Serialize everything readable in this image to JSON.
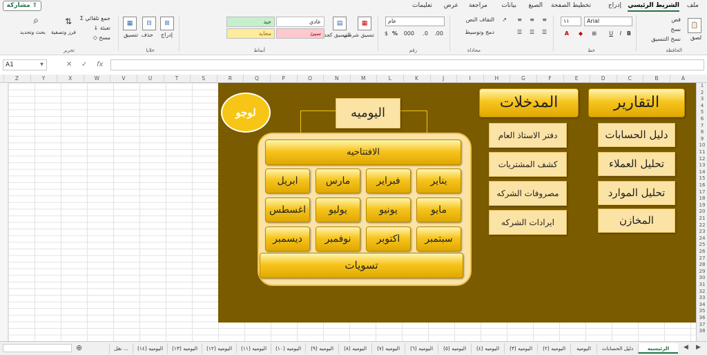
{
  "menu": {
    "file": "ملف",
    "home": "الشريط الرئيسي",
    "insert": "إدراج",
    "page_layout": "تخطيط الصفحة",
    "formulas": "الصيغ",
    "data": "بيانات",
    "review": "مراجعة",
    "view": "عرض",
    "help": "تعليمات",
    "share": "مشاركة"
  },
  "ribbon": {
    "clipboard": {
      "paste": "لصق",
      "cut": "قص",
      "copy": "نسخ",
      "format_painter": "نسخ التنسيق",
      "label": "الحافظة"
    },
    "font": {
      "name": "Arial",
      "size": "١١",
      "label": "خط"
    },
    "alignment": {
      "wrap": "التفاف النص",
      "merge": "دمج وتوسيط",
      "label": "محاذاة"
    },
    "number": {
      "format": "عام",
      "label": "رقم"
    },
    "styles": {
      "conditional": "تنسيق شرطي",
      "table": "التنسيق كجدول",
      "normal": "عادي",
      "good": "جيد",
      "bad": "سيئ",
      "neutral": "محايد",
      "label": "أنماط"
    },
    "cells": {
      "insert": "إدراج",
      "delete": "حذف",
      "format": "تنسيق",
      "label": "خلايا"
    },
    "editing": {
      "autosum": "جمع تلقائي",
      "fill": "تعبئة",
      "clear": "مسح",
      "sort": "فرز وتصفية",
      "find": "بحث وتحديد",
      "label": "تحرير"
    }
  },
  "formula_bar": {
    "name_box": "A1",
    "fx": "fx",
    "value": ""
  },
  "columns": [
    "A",
    "B",
    "C",
    "D",
    "E",
    "F",
    "G",
    "H",
    "I",
    "J",
    "K",
    "L",
    "M",
    "N",
    "O",
    "P",
    "Q",
    "R",
    "S",
    "T",
    "U",
    "V",
    "W",
    "X",
    "Y",
    "Z"
  ],
  "rows": [
    "1",
    "2",
    "3",
    "4",
    "5",
    "6",
    "7",
    "8",
    "9",
    "10",
    "11",
    "12",
    "13",
    "14",
    "15",
    "16",
    "17",
    "18",
    "19",
    "20",
    "21",
    "22",
    "23",
    "24",
    "25",
    "26",
    "27",
    "28",
    "29",
    "30",
    "31",
    "32",
    "33",
    "34",
    "35",
    "36",
    "37",
    "38"
  ],
  "dashboard": {
    "logo": "لوجو",
    "reports_title": "التقارير",
    "reports": [
      "دليل الحسابات",
      "تحليل العملاء",
      "تحليل الموارد",
      "المخازن"
    ],
    "inputs_title": "المدخلات",
    "inputs": [
      "دفتر الاستاذ العام",
      "كشف المشتريات",
      "مصروفات الشركه",
      "ايرادات الشركه"
    ],
    "daily_title": "اليوميه",
    "opening": "الافتتاحيه",
    "months": [
      "يناير",
      "فبراير",
      "مارس",
      "ابريل",
      "مايو",
      "يونيو",
      "يوليو",
      "اغسطس",
      "سبتمبر",
      "اكتوبر",
      "نوفمبر",
      "ديسمبر"
    ],
    "settlements": "تسويات"
  },
  "sheet_tabs": [
    "الرئيسيه",
    "دليل الحسابات",
    "اليوميه",
    "اليوميه (٢)",
    "اليوميه (٣)",
    "اليوميه (٤)",
    "اليوميه (٥)",
    "اليوميه (٦)",
    "اليوميه (٧)",
    "اليوميه (٨)",
    "اليوميه (٩)",
    "اليوميه (١٠)",
    "اليوميه (١١)",
    "اليوميه (١٢)",
    "اليوميه (١٣)",
    "اليوميه (١٤)",
    "نقل ..."
  ],
  "colors": {
    "dashboard_bg": "#7a5b00",
    "gold": "#f7c51f",
    "cream": "#fbe3a6",
    "excel_green": "#217346"
  }
}
